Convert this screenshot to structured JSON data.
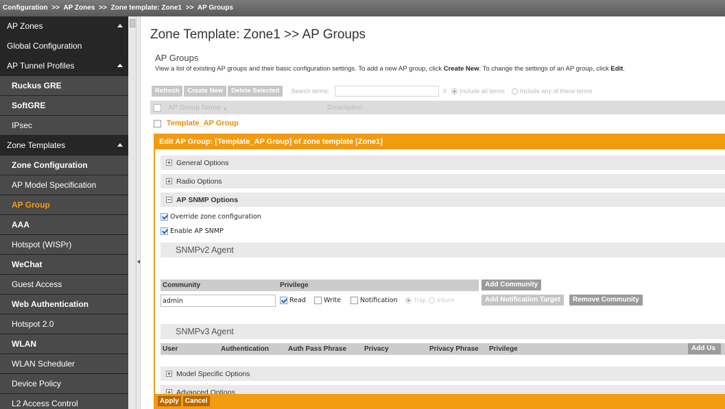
{
  "breadcrumb": {
    "items": [
      "Configuration",
      "AP Zones",
      "Zone template: Zone1",
      "AP Groups"
    ],
    "separator": ">>"
  },
  "sidebar": {
    "items": [
      {
        "label": "AP Zones"
      },
      {
        "label": "Global Configuration"
      },
      {
        "label": "AP Tunnel Profiles"
      },
      {
        "label": "Ruckus GRE"
      },
      {
        "label": "SoftGRE"
      },
      {
        "label": "IPsec"
      },
      {
        "label": "Zone Templates"
      },
      {
        "label": "Zone Configuration"
      },
      {
        "label": "AP Model Specification"
      },
      {
        "label": "AP Group"
      },
      {
        "label": "AAA"
      },
      {
        "label": "Hotspot (WISPr)"
      },
      {
        "label": "WeChat"
      },
      {
        "label": "Guest Access"
      },
      {
        "label": "Web Authentication"
      },
      {
        "label": "Hotspot 2.0"
      },
      {
        "label": "WLAN"
      },
      {
        "label": "WLAN Scheduler"
      },
      {
        "label": "Device Policy"
      },
      {
        "label": "L2 Access Control"
      }
    ]
  },
  "main": {
    "title": "Zone Template: Zone1 >> AP Groups",
    "section": "AP Groups",
    "description": {
      "part1": "View a list of existing AP groups and their basic configuration settings. To add a new AP group, click ",
      "create_new": "Create New",
      "part2": ". To change the settings of an AP group, click ",
      "edit": "Edit",
      "part3": "."
    },
    "toolbar": {
      "refresh": "Refresh",
      "create_new": "Create New",
      "delete_selected": "Delete Selected",
      "search_label": "Search terms:",
      "search_value": "",
      "clear": "X",
      "include_all": "Include all terms",
      "include_any": "Include any of these terms"
    },
    "table": {
      "col_name": "AP Group Name",
      "col_desc": "Description",
      "sort_indicator": "▲",
      "rows": [
        {
          "name": "Template_AP Group",
          "description": ""
        }
      ]
    }
  },
  "edit_panel": {
    "header": "Edit AP Group: [Template_AP Group] of zone template [Zone1]",
    "sections": {
      "general": "General Options",
      "radio": "Radio Options",
      "snmp": "AP SNMP Options",
      "model": "Model Specific Options",
      "advanced": "Advanced Options"
    },
    "override_label": "Override zone configuration",
    "enable_snmp_label": "Enable AP SNMP",
    "snmpv2": {
      "title": "SNMPv2 Agent",
      "col_community": "Community",
      "col_privilege": "Privilege",
      "add_community": "Add Community",
      "community_value": "admin",
      "read": "Read",
      "write": "Write",
      "notification": "Notification",
      "trap": "Trap",
      "inform": "Inform",
      "add_target": "Add Notification Target",
      "remove_community": "Remove Community"
    },
    "snmpv3": {
      "title": "SNMPv3 Agent",
      "col_user": "User",
      "col_auth": "Authentication",
      "col_auth_pass": "Auth Pass Phrase",
      "col_privacy": "Privacy",
      "col_privacy_pass": "Privacy Phrase",
      "col_privilege": "Privilege",
      "add_user": "Add Us"
    },
    "apply": "Apply",
    "cancel": "Cancel"
  },
  "colors": {
    "accent": "#f39b10",
    "link": "#f28b0d",
    "sidebar_bg": "#3d3d3d"
  }
}
